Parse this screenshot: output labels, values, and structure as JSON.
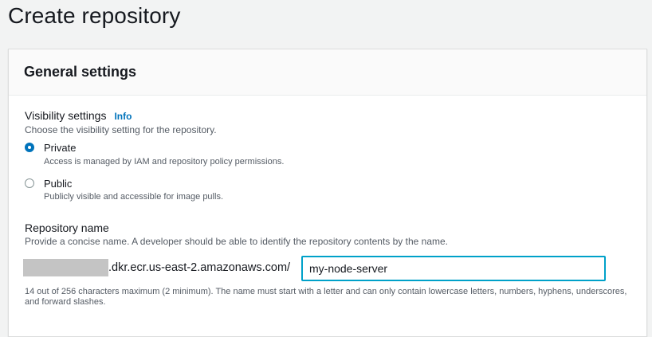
{
  "page": {
    "title": "Create repository"
  },
  "general_settings": {
    "title": "General settings",
    "visibility": {
      "label": "Visibility settings",
      "info_link": "Info",
      "description": "Choose the visibility setting for the repository.",
      "options": [
        {
          "label": "Private",
          "description": "Access is managed by IAM and repository policy permissions.",
          "selected": true
        },
        {
          "label": "Public",
          "description": "Publicly visible and accessible for image pulls.",
          "selected": false
        }
      ]
    },
    "repository_name": {
      "label": "Repository name",
      "description": "Provide a concise name. A developer should be able to identify the repository contents by the name.",
      "uri_suffix": ".dkr.ecr.us-east-2.amazonaws.com/",
      "value": "my-node-server",
      "constraint": "14 out of 256 characters maximum (2 minimum). The name must start with a letter and can only contain lowercase letters, numbers, hyphens, underscores, and forward slashes."
    }
  },
  "colors": {
    "accent": "#0073bb",
    "focus_border": "#00a1c9",
    "text": "#16191f",
    "muted_text": "#545b64"
  },
  "icons": {
    "radio_selected": "radio-checked-icon",
    "radio_unselected": "radio-unchecked-icon"
  }
}
